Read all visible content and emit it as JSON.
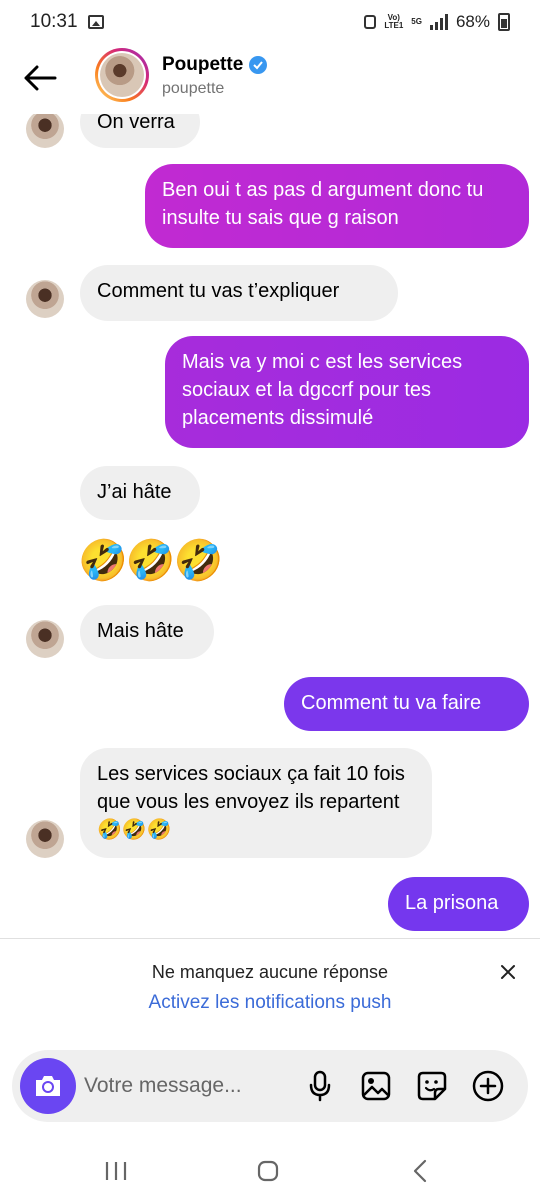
{
  "status_bar": {
    "time": "10:31",
    "network_top": "Vo)",
    "network_bottom": "LTE1",
    "gen": "5G",
    "battery": "68%"
  },
  "header": {
    "name": "Poupette",
    "handle": "poupette",
    "back_icon": "arrow-left-icon",
    "verified_icon": "verified-badge-icon"
  },
  "messages": [
    {
      "from": "them",
      "text": "On verra"
    },
    {
      "from": "me",
      "text": "Ben oui t as pas d argument donc tu insulte tu sais que g raison"
    },
    {
      "from": "them",
      "text": "Comment tu vas t’expliquer"
    },
    {
      "from": "me",
      "text": "Mais va y moi c est les services sociaux et la dgccrf pour tes placements dissimulé"
    },
    {
      "from": "them",
      "text": "J’ai hâte"
    },
    {
      "from": "them",
      "text": "🤣🤣🤣"
    },
    {
      "from": "them",
      "text": "Mais hâte"
    },
    {
      "from": "me",
      "text": "Comment tu va faire"
    },
    {
      "from": "them",
      "text": "Les services sociaux ça fait 10 fois que vous les envoyez ils repartent 🤣🤣🤣"
    },
    {
      "from": "me",
      "text": "La prisona"
    }
  ],
  "notification": {
    "title": "Ne manquez aucune réponse",
    "link": "Activez les notifications push"
  },
  "composer": {
    "placeholder": "Votre message...",
    "icons": [
      "camera-icon",
      "microphone-icon",
      "gallery-icon",
      "sticker-icon",
      "plus-icon"
    ]
  },
  "colors": {
    "outgoing_top": "#b92ad4",
    "outgoing_bottom": "#7a36ec",
    "incoming": "#efefef",
    "link": "#3b6bd8",
    "camera": "#6a46f2"
  }
}
